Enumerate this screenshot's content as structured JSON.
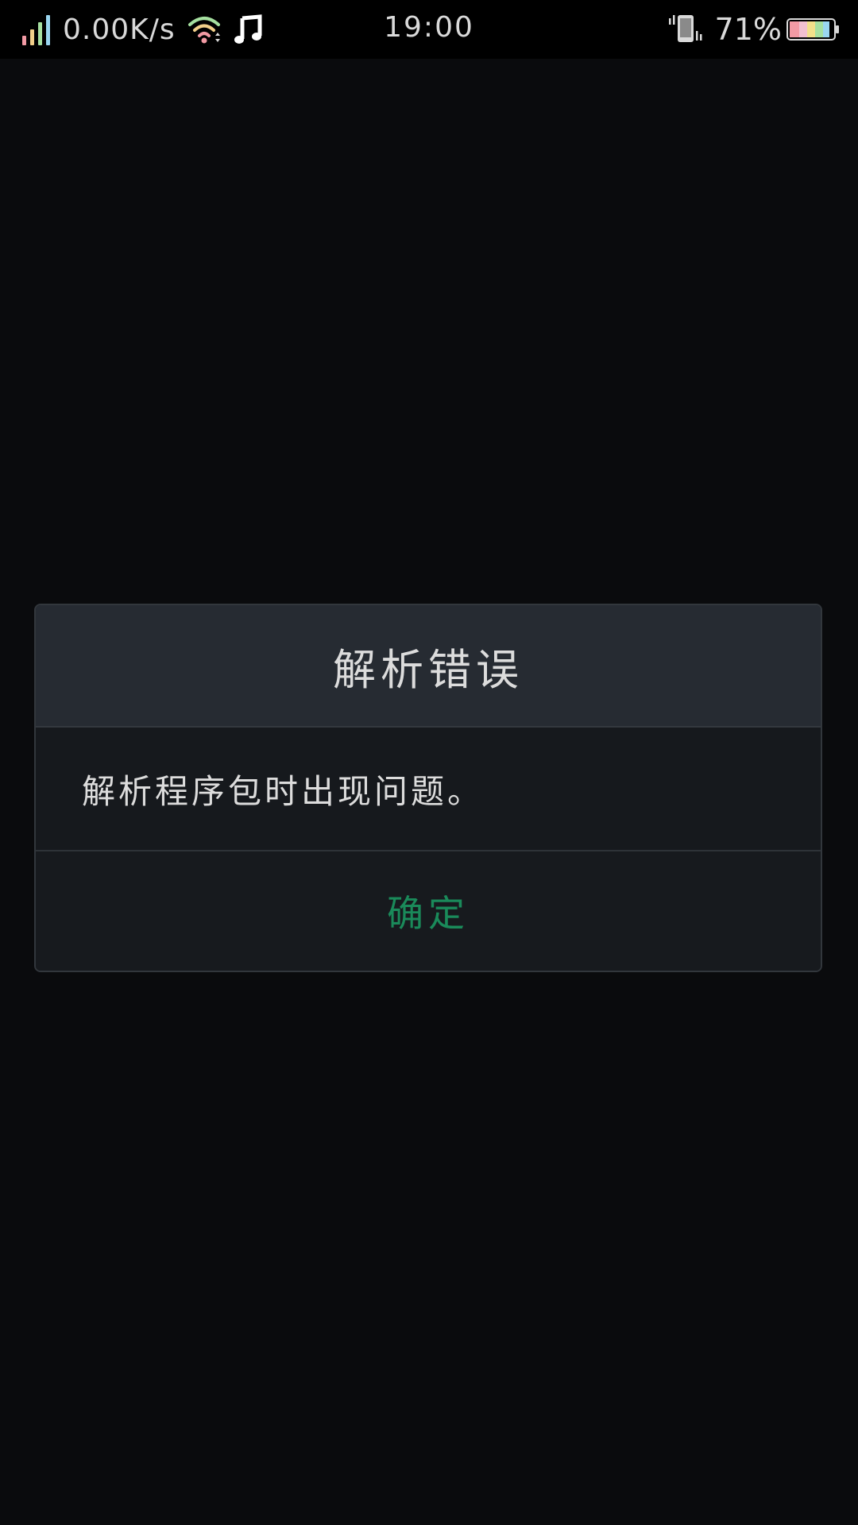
{
  "status_bar": {
    "net_speed": "0.00K/s",
    "time": "19:00",
    "battery_percent": "71%",
    "icons": {
      "signal": "signal-icon",
      "wifi": "wifi-icon",
      "music": "music-note-icon",
      "vibrate": "vibrate-icon",
      "battery": "battery-icon"
    },
    "colors": {
      "signal_bars": [
        "#f29aa4",
        "#f2d08a",
        "#a6e0a0",
        "#9ad6f0"
      ]
    }
  },
  "dialog": {
    "title": "解析错误",
    "message": "解析程序包时出现问题。",
    "confirm_label": "确定",
    "colors": {
      "confirm": "#1a8a5a",
      "header_bg": "#262b32",
      "body_bg": "#171a1e"
    }
  }
}
